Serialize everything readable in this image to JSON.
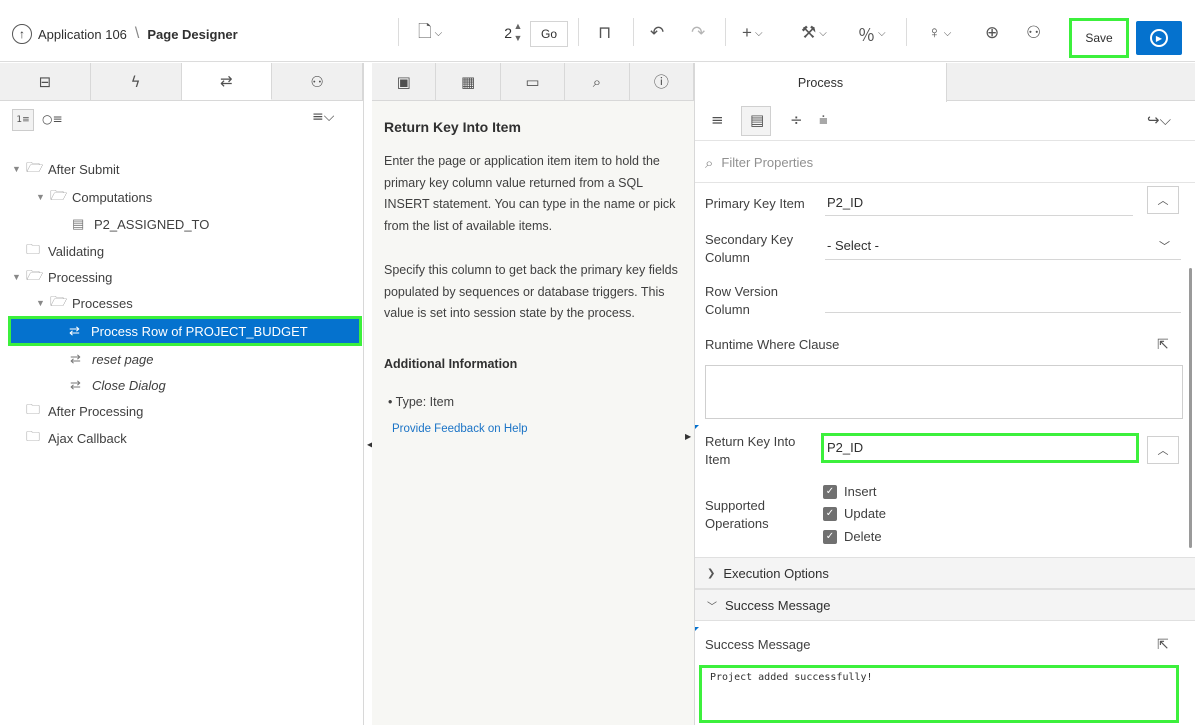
{
  "toolbar": {
    "app_name": "Application 106",
    "separator": "\\",
    "page_designer": "Page Designer",
    "page_number": "2",
    "go_label": "Go",
    "save_label": "Save"
  },
  "left_tabs": [
    "rendering-tab",
    "dynamic-actions-tab",
    "processing-tab",
    "shared-components-tab"
  ],
  "tree": {
    "after_submit": "After Submit",
    "computations": "Computations",
    "p2_assigned_to": "P2_ASSIGNED_TO",
    "validating": "Validating",
    "processing": "Processing",
    "processes": "Processes",
    "selected_process": "Process Row of PROJECT_BUDGET",
    "reset_page": "reset page",
    "close_dialog": "Close Dialog",
    "after_processing": "After Processing",
    "ajax_callback": "Ajax Callback"
  },
  "help": {
    "title": "Return Key Into Item",
    "para1": "Enter the page or application item item to hold the primary key column value returned from a SQL INSERT statement. You can type in the name or pick from the list of available items.",
    "para2": "Specify this column to get back the primary key fields populated by sequences or database triggers. This value is set into session state by the process.",
    "subtitle": "Additional Information",
    "bullet": "Type: Item",
    "feedback_link": "Provide Feedback on Help"
  },
  "property_editor": {
    "tab_label": "Process",
    "filter_placeholder": "Filter Properties",
    "primary_key_label": "Primary Key Item",
    "primary_key_value": "P2_ID",
    "secondary_key_label": "Secondary Key Column",
    "secondary_key_value": "- Select -",
    "row_version_label": "Row Version Column",
    "runtime_where_label": "Runtime Where Clause",
    "return_key_label": "Return Key Into Item",
    "return_key_value": "P2_ID",
    "supported_ops_label": "Supported Operations",
    "op_insert": "Insert",
    "op_update": "Update",
    "op_delete": "Delete",
    "execution_options": "Execution Options",
    "success_message_group": "Success Message",
    "success_message_label": "Success Message",
    "success_message_value": "Project added successfully!"
  },
  "colors": {
    "accent": "#0572ce",
    "highlight": "#3cf03c"
  }
}
